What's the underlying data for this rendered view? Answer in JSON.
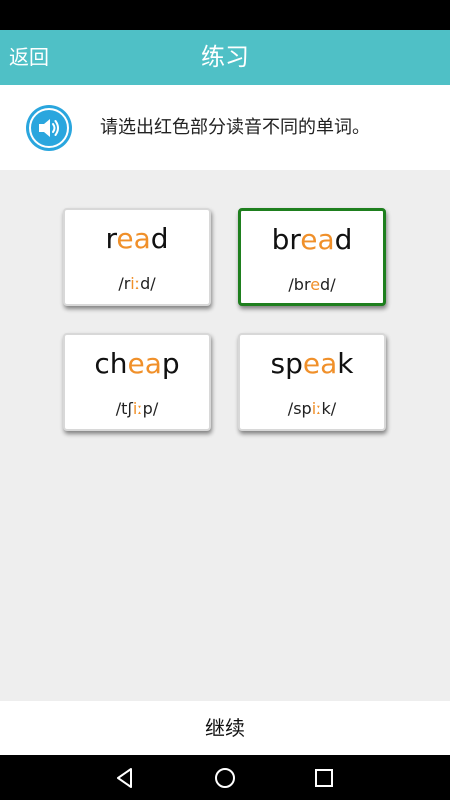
{
  "header": {
    "back_label": "返回",
    "title": "练习"
  },
  "prompt": {
    "instruction": "请选出红色部分读音不同的单词。"
  },
  "colors": {
    "accent": "#4fc0c6",
    "highlight": "#f0902a",
    "selected_border": "#1e7f1e",
    "speaker": "#2aa6de"
  },
  "cards": [
    {
      "word": {
        "pre": "r",
        "mid": "ea",
        "post": "d"
      },
      "ipa": {
        "pre": "/r",
        "mid": "iː",
        "post": "d/"
      },
      "selected": false
    },
    {
      "word": {
        "pre": "br",
        "mid": "ea",
        "post": "d"
      },
      "ipa": {
        "pre": "/br",
        "mid": "e",
        "post": "d/"
      },
      "selected": true
    },
    {
      "word": {
        "pre": "ch",
        "mid": "ea",
        "post": "p"
      },
      "ipa": {
        "pre": "/tʃ",
        "mid": "iː",
        "post": "p/"
      },
      "selected": false
    },
    {
      "word": {
        "pre": "sp",
        "mid": "ea",
        "post": "k"
      },
      "ipa": {
        "pre": "/sp",
        "mid": "iː",
        "post": "k/"
      },
      "selected": false
    }
  ],
  "footer": {
    "continue_label": "继续"
  },
  "icons": {
    "speaker": "speaker-icon",
    "back": "back-triangle-icon",
    "home": "home-circle-icon",
    "recents": "recents-square-icon"
  }
}
